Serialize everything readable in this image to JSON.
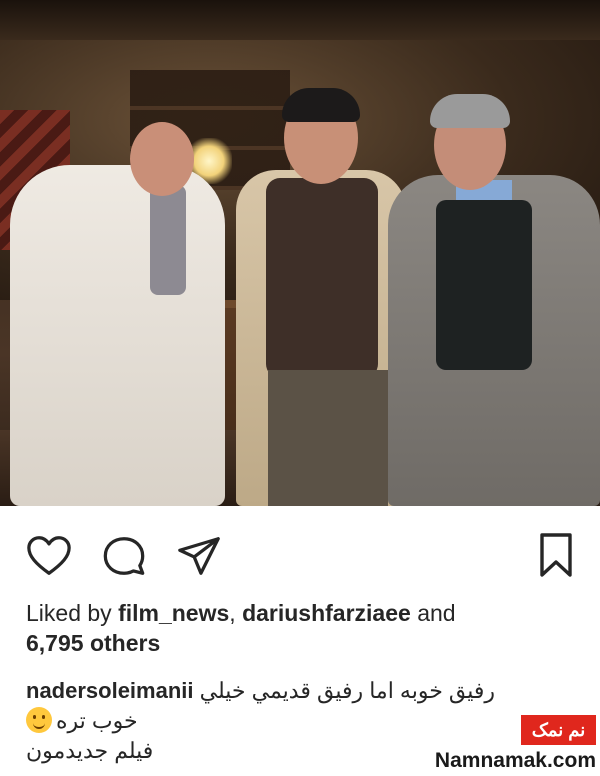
{
  "post": {
    "likes_prefix": "Liked by ",
    "liker_1": "film_news",
    "separator": ", ",
    "liker_2": "dariushfarziaee",
    "likes_and": " and",
    "others_count": "6,795 others"
  },
  "caption": {
    "username": "nadersoleimanii",
    "line1_text": "رفيق خوبه اما رفيق قديمي خيلي",
    "line2_text": "خوب تره",
    "emoji_name": "hugging-face-emoji",
    "line3_text": "فيلم جديدمون"
  },
  "watermark": {
    "badge_text": "نم نمک",
    "site_text": "Namnamak.com",
    "badge_color": "#e0271d"
  },
  "icons": {
    "like": "heart-icon",
    "comment": "comment-icon",
    "share": "share-icon",
    "save": "bookmark-icon"
  }
}
